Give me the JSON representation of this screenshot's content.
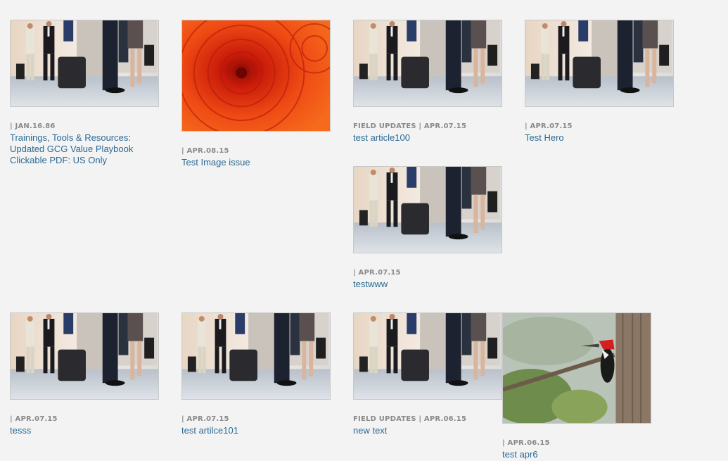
{
  "articles": [
    {
      "date": "| JAN.16.86",
      "title": "Trainings, Tools & Resources: Updated GCG Value Playbook Clickable PDF: US Only",
      "image": "business-travelers-photo"
    },
    {
      "date": "| APR.08.15",
      "title": "Test Image issue",
      "image": "orange-flower-photo"
    },
    {
      "date": "FIELD UPDATES | APR.07.15",
      "title": "test article100",
      "image": "business-travelers-photo"
    },
    {
      "date": "| APR.07.15",
      "title": "Test Hero",
      "image": "business-travelers-photo"
    },
    {
      "date": "| APR.07.15",
      "title": "testwww",
      "image": "business-travelers-photo"
    },
    {
      "date": "| APR.07.15",
      "title": "tesss",
      "image": "business-travelers-photo"
    },
    {
      "date": "| APR.07.15",
      "title": "test artilce101",
      "image": "business-travelers-photo"
    },
    {
      "date": "FIELD UPDATES | APR.06.15",
      "title": "new text",
      "image": "business-travelers-photo"
    },
    {
      "date": "| APR.06.15",
      "title": "test apr6",
      "image": "woodpecker-photo"
    }
  ]
}
